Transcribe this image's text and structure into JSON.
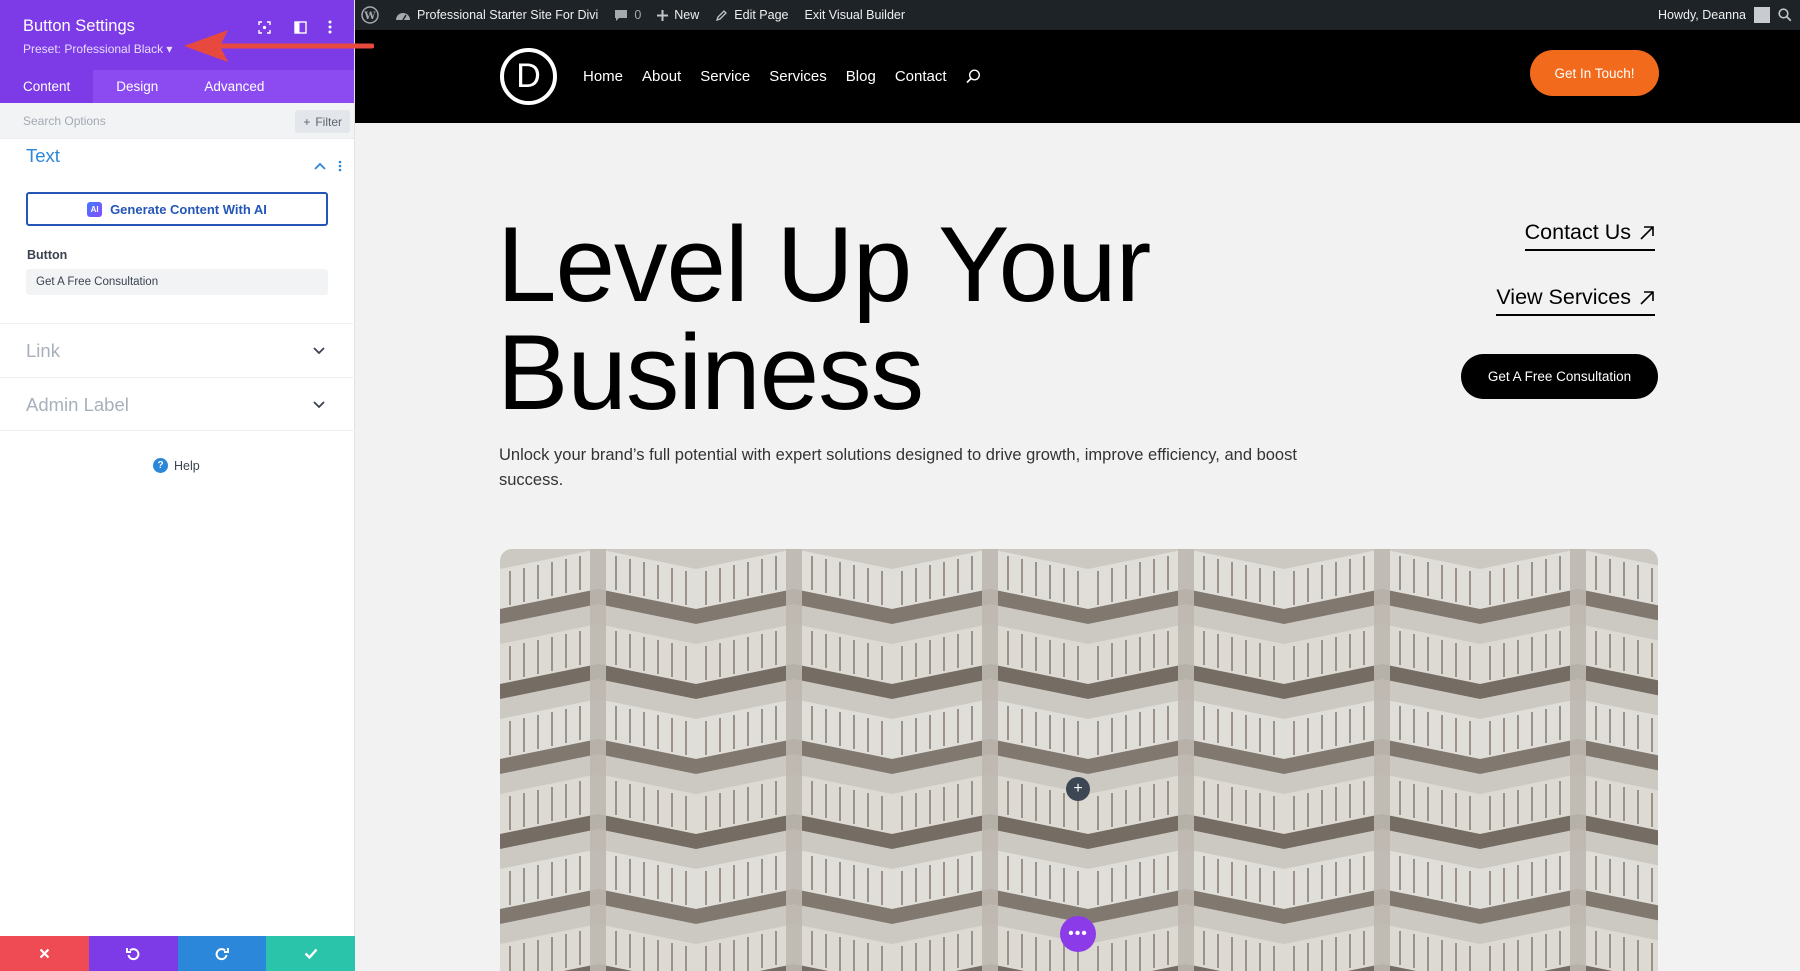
{
  "panel": {
    "title": "Button Settings",
    "preset": "Preset: Professional Black ▾",
    "tabs": [
      {
        "label": "Content",
        "active": true
      },
      {
        "label": "Design",
        "active": false
      },
      {
        "label": "Advanced",
        "active": false
      }
    ],
    "search_placeholder": "Search Options",
    "filter_label": "Filter",
    "text_section": {
      "title": "Text",
      "ai_button": "Generate Content With AI",
      "ai_badge": "AI",
      "field_label": "Button",
      "field_value": "Get A Free Consultation"
    },
    "link_section": "Link",
    "admin_section": "Admin Label",
    "help": "Help",
    "help_icon": "?",
    "colors": {
      "header": "#7d3be8",
      "tabs": "#8c4bf0",
      "accent": "#2b87da",
      "close": "#ef4b55",
      "undo": "#7d3be8",
      "redo": "#2b87da",
      "save": "#29c4a9"
    }
  },
  "adminbar": {
    "site_name": "Professional Starter Site For Divi",
    "comments": "0",
    "new": "New",
    "edit_page": "Edit Page",
    "exit_builder": "Exit Visual Builder",
    "howdy": "Howdy, Deanna"
  },
  "site": {
    "logo": "D",
    "nav": [
      "Home",
      "About",
      "Service",
      "Services",
      "Blog",
      "Contact"
    ],
    "cta": "Get In Touch!",
    "hero_title_1": "Level Up Your",
    "hero_title_2": "Business",
    "hero_sub": "Unlock your brand’s full potential with expert solutions designed to drive growth, improve efficiency, and boost success.",
    "contact_link": "Contact Us",
    "services_link": "View Services",
    "consult_button": "Get A Free Consultation",
    "add_icon": "+",
    "more_icon": "•••",
    "colors": {
      "cta": "#f26a1b",
      "header": "#000000",
      "builder_purple": "#8c3be8"
    }
  }
}
